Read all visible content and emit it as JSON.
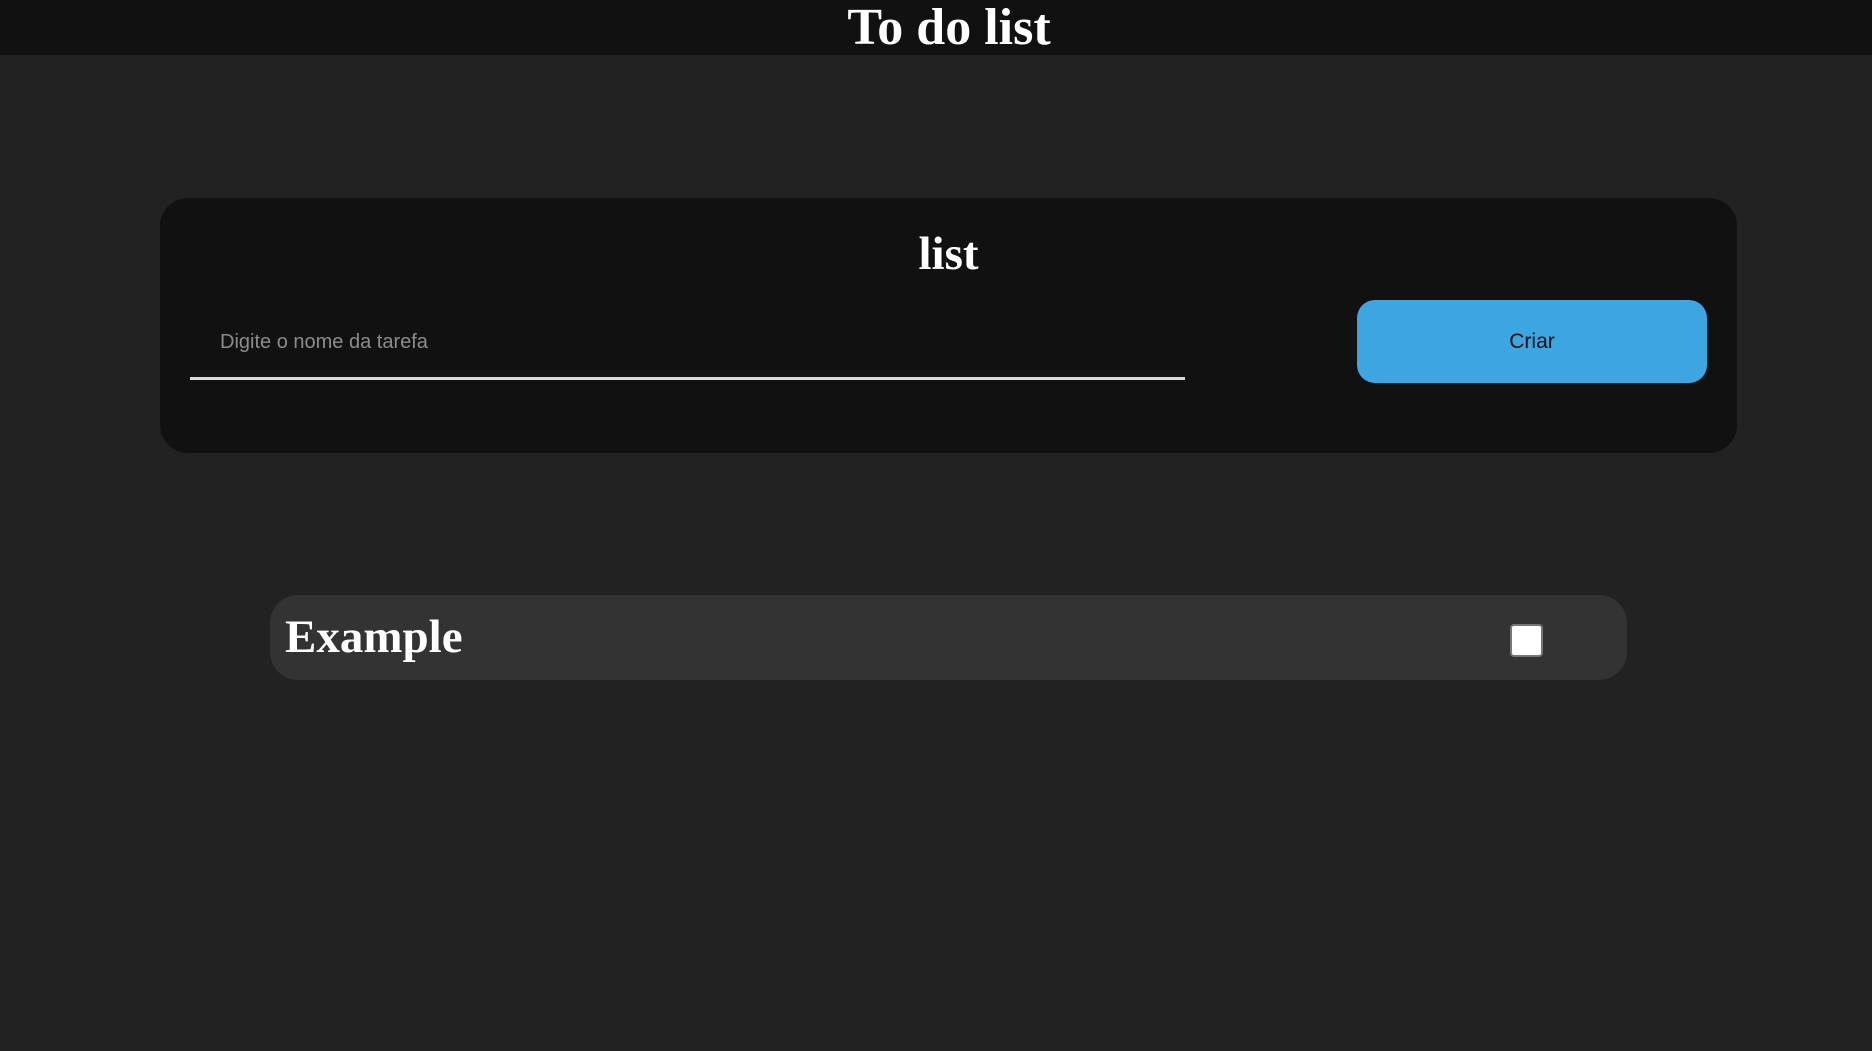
{
  "header": {
    "title": "To do list"
  },
  "list_card": {
    "heading": "list",
    "input": {
      "placeholder": "Digite o nome da tarefa",
      "value": ""
    },
    "create_label": "Criar"
  },
  "tasks": [
    {
      "label": "Example",
      "checked": false
    }
  ],
  "colors": {
    "background": "#222222",
    "header_bar": "#111111",
    "card": "#111111",
    "task_item": "#333333",
    "accent_button": "#3da5e0",
    "input_underline": "#d9d9d9"
  }
}
